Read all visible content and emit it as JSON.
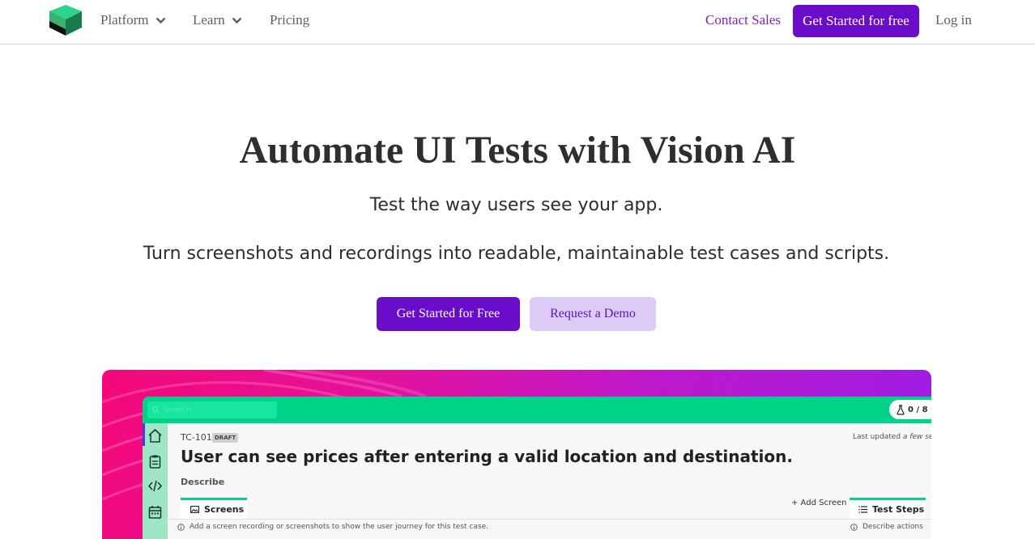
{
  "nav": {
    "logo_name": "brand-logo",
    "items": [
      {
        "label": "Platform",
        "has_dropdown": true
      },
      {
        "label": "Learn",
        "has_dropdown": true
      },
      {
        "label": "Pricing",
        "has_dropdown": false
      }
    ],
    "contact_sales": "Contact Sales",
    "cta": "Get Started for free",
    "login": "Log in"
  },
  "hero": {
    "title": "Automate UI Tests with Vision AI",
    "subtitle": "Test the way users see your app.",
    "description": "Turn screenshots and recordings into readable, maintainable test cases and scripts.",
    "primary_button": "Get Started for Free",
    "secondary_button": "Request a Demo"
  },
  "preview": {
    "search_placeholder": "Search...",
    "credits": "0 / 8",
    "sidebar_icons": [
      "home-icon",
      "clipboard-icon",
      "code-icon",
      "calendar-icon"
    ],
    "test_case": {
      "id": "TC-101",
      "status": "DRAFT",
      "last_updated_prefix": "Last updated",
      "last_updated_value": "a few sec",
      "title": "User can see prices after entering a valid location and destination.",
      "describe_label": "Describe"
    },
    "tabs": {
      "screens": "Screens",
      "add_screen": "+ Add Screen",
      "test_steps": "Test Steps"
    },
    "hint": "Add a screen recording or screenshots to show the user journey for this test case.",
    "steps_hint": "Describe actions"
  },
  "colors": {
    "brand_purple": "#6a0dcb",
    "secondary_button_bg": "#dccbf7",
    "accent_green": "#00d387",
    "contact_link": "#7a1fc4"
  }
}
